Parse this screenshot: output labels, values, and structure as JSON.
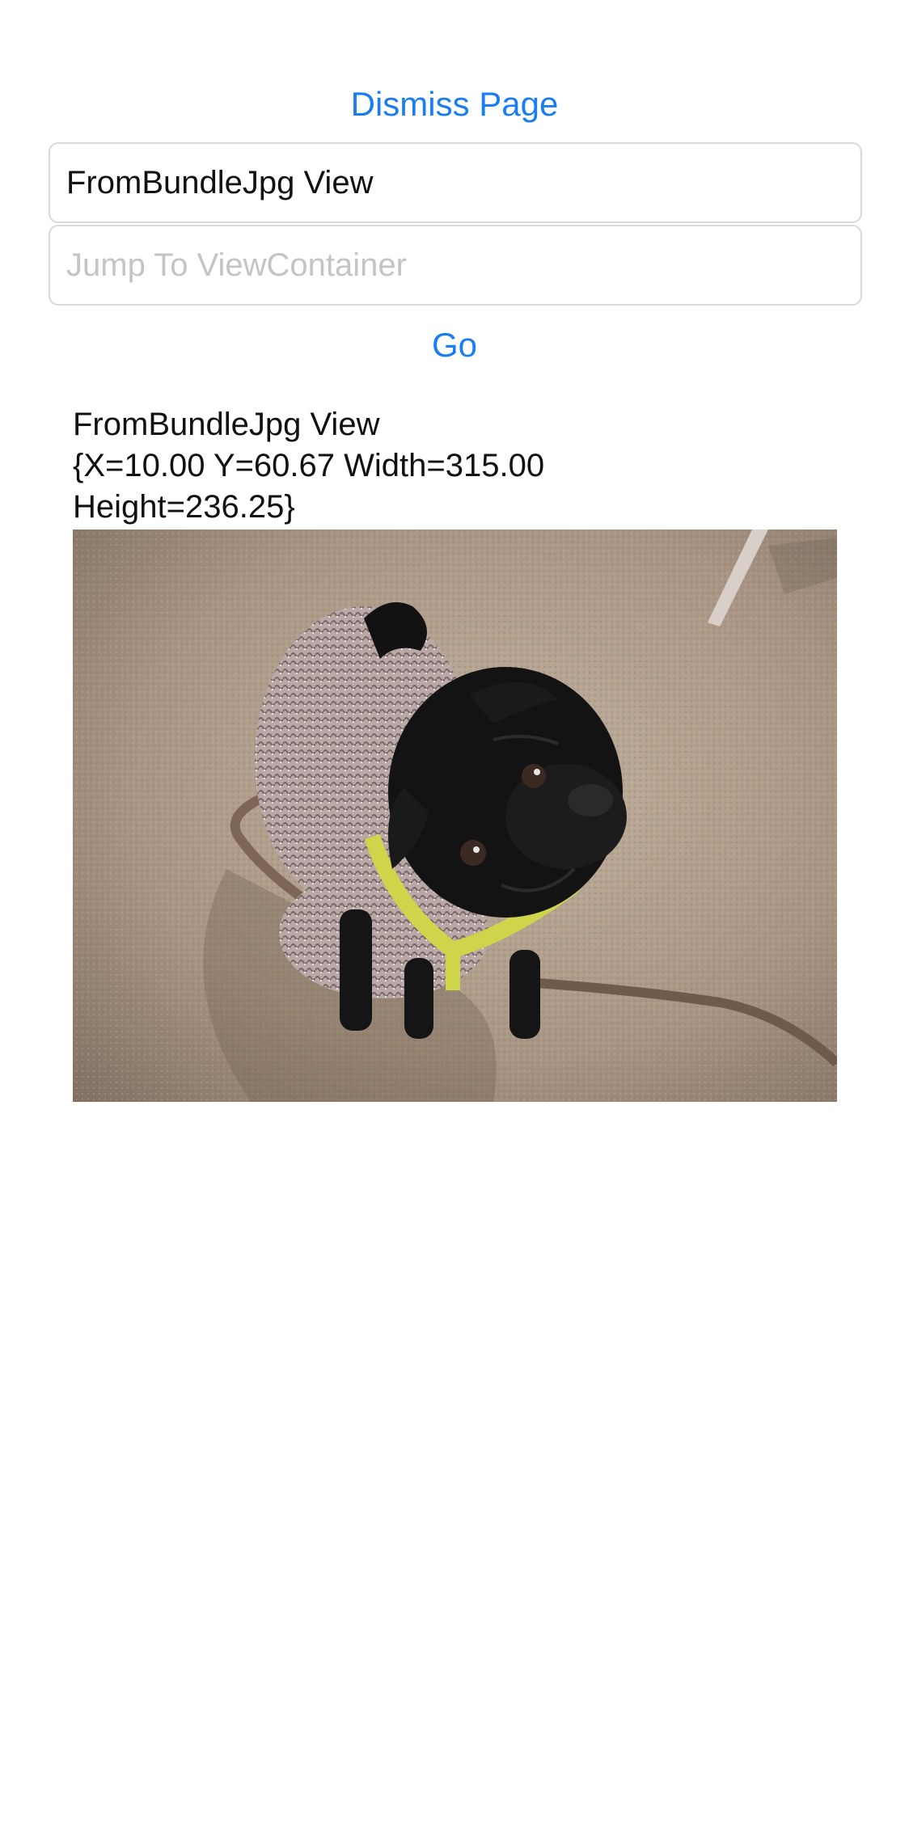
{
  "header": {
    "dismiss_label": "Dismiss Page"
  },
  "form": {
    "selected_view": "FromBundleJpg View",
    "jump_placeholder": "Jump To ViewContainer",
    "jump_value": "",
    "go_label": "Go"
  },
  "content": {
    "view_title": "FromBundleJpg View",
    "bounds_line1": "{X=10.00 Y=60.67 Width=315.00",
    "bounds_line2": "Height=236.25}"
  },
  "colors": {
    "accent": "#1a7ef2",
    "border": "#d9d9d9",
    "placeholder": "#c4c4c6"
  }
}
